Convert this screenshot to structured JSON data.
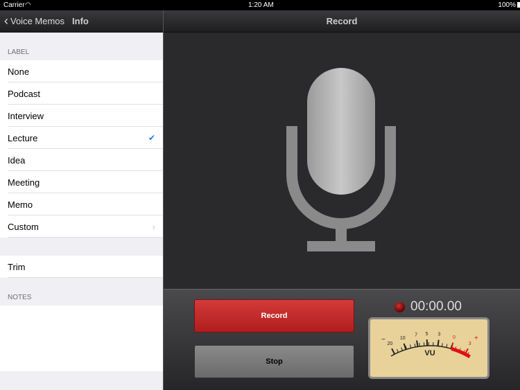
{
  "status": {
    "carrier": "Carrier",
    "time": "1:20 AM",
    "battery": "100%"
  },
  "left": {
    "back_label": "Voice Memos",
    "title": "Info",
    "label_header": "LABEL",
    "labels": [
      {
        "label": "None"
      },
      {
        "label": "Podcast"
      },
      {
        "label": "Interview"
      },
      {
        "label": "Lecture",
        "selected": true
      },
      {
        "label": "Idea"
      },
      {
        "label": "Meeting"
      },
      {
        "label": "Memo"
      },
      {
        "label": "Custom",
        "disclosure": true
      }
    ],
    "trim": "Trim",
    "notes_header": "NOTES",
    "notes": ""
  },
  "right": {
    "title": "Record",
    "record_label": "Record",
    "stop_label": "Stop",
    "timer": "00:00.00",
    "vu": {
      "label": "VU",
      "minus": "−",
      "plus": "+",
      "ticks": [
        "20",
        "10",
        "7",
        "5",
        "3",
        "0",
        "3"
      ],
      "level": 0
    },
    "accent": "#c42525"
  }
}
